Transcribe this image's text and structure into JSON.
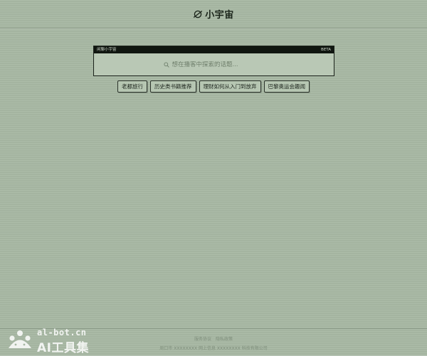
{
  "header": {
    "title": "小宇宙",
    "icon": "planet-icon"
  },
  "search_panel": {
    "bar_left": "闲聊小宇宙",
    "bar_right": "BETA",
    "placeholder": "想在播客中探索的话题..."
  },
  "suggestions": [
    {
      "label": "老都旅行"
    },
    {
      "label": "历史类书籍推荐"
    },
    {
      "label": "理财如何从入门到放弃"
    },
    {
      "label": "巴黎奥运会趣闻"
    }
  ],
  "footer": {
    "links": [
      "服务协议",
      "隐私政策"
    ],
    "copyright": "周口市 XXXXXXXX 网上信息 XXXXXXXX 科技有限公司"
  },
  "watermark": {
    "domain": "al-bot.cn",
    "name": "AI工具集"
  },
  "colors": {
    "background": "#a8b8a4",
    "panel_bar": "#101610",
    "border": "#1c231c"
  }
}
